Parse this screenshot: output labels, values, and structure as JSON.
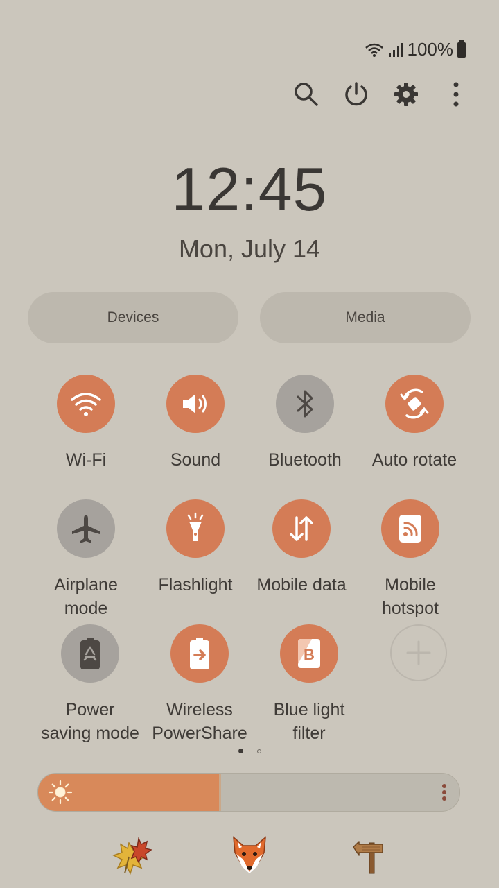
{
  "status": {
    "battery_text": "100%"
  },
  "header": {
    "icons": [
      "search-icon",
      "power-icon",
      "settings-icon",
      "more-options-icon"
    ]
  },
  "clock": {
    "time": "12:45",
    "date": "Mon, July 14"
  },
  "panels": {
    "devices_label": "Devices",
    "media_label": "Media"
  },
  "tiles": [
    {
      "label": "Wi-Fi",
      "state": "on",
      "icon": "wifi-icon"
    },
    {
      "label": "Sound",
      "state": "on",
      "icon": "sound-icon"
    },
    {
      "label": "Bluetooth",
      "state": "off",
      "icon": "bluetooth-icon"
    },
    {
      "label": "Auto rotate",
      "state": "on",
      "icon": "auto-rotate-icon"
    },
    {
      "label": "Airplane mode",
      "state": "off",
      "icon": "airplane-icon"
    },
    {
      "label": "Flashlight",
      "state": "on",
      "icon": "flashlight-icon"
    },
    {
      "label": "Mobile data",
      "state": "on",
      "icon": "mobile-data-icon"
    },
    {
      "label": "Mobile hotspot",
      "state": "on",
      "icon": "hotspot-icon"
    },
    {
      "label": "Power saving mode",
      "state": "off",
      "icon": "power-saving-icon"
    },
    {
      "label": "Wireless PowerShare",
      "state": "on",
      "icon": "wireless-powershare-icon"
    },
    {
      "label": "Blue light filter",
      "state": "on",
      "icon": "blue-light-filter-icon"
    },
    {
      "label": "",
      "state": "add",
      "icon": "add-icon"
    }
  ],
  "pager": {
    "current": 1,
    "total": 2
  },
  "brightness": {
    "level": 0.43,
    "icon": "sun-icon"
  },
  "dock": [
    "autumn-leaves-icon",
    "fox-icon",
    "signpost-icon"
  ],
  "colors": {
    "accent": "#d47c56",
    "background": "#cbc6bc",
    "inactive": "#a6a29d"
  }
}
